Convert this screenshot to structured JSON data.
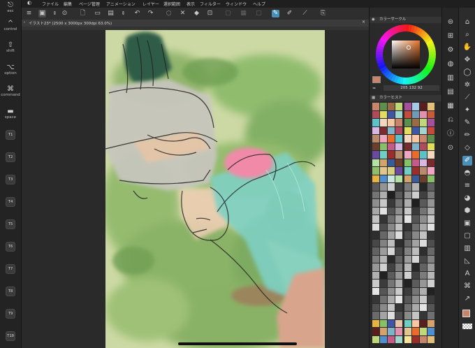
{
  "keys": {
    "esc": "esc",
    "control": "control",
    "shift": "shift",
    "option": "option",
    "command": "command",
    "space": "space",
    "t_keys": [
      "T1",
      "T2",
      "T3",
      "T4",
      "T5",
      "T6",
      "T7",
      "T8",
      "T9",
      "T10"
    ]
  },
  "menu": {
    "items": [
      "ファイル",
      "編集",
      "ページ管理",
      "アニメーション",
      "レイヤー",
      "選択範囲",
      "表示",
      "フィルター",
      "ウィンドウ",
      "ヘルプ"
    ]
  },
  "document": {
    "tab_title": "イラスト23* (2500 x 3000px 300dpi 63.0%)"
  },
  "color_wheel": {
    "title": "カラーサークル",
    "hsv_readout": "205 132 92"
  },
  "color_history": {
    "title": "カラーヒスト"
  },
  "colors": {
    "accent": "#4a8fb8",
    "canvas_bg": "#cdd9a4",
    "main_color": "#c8856a",
    "sub_color": "#ffffff"
  }
}
